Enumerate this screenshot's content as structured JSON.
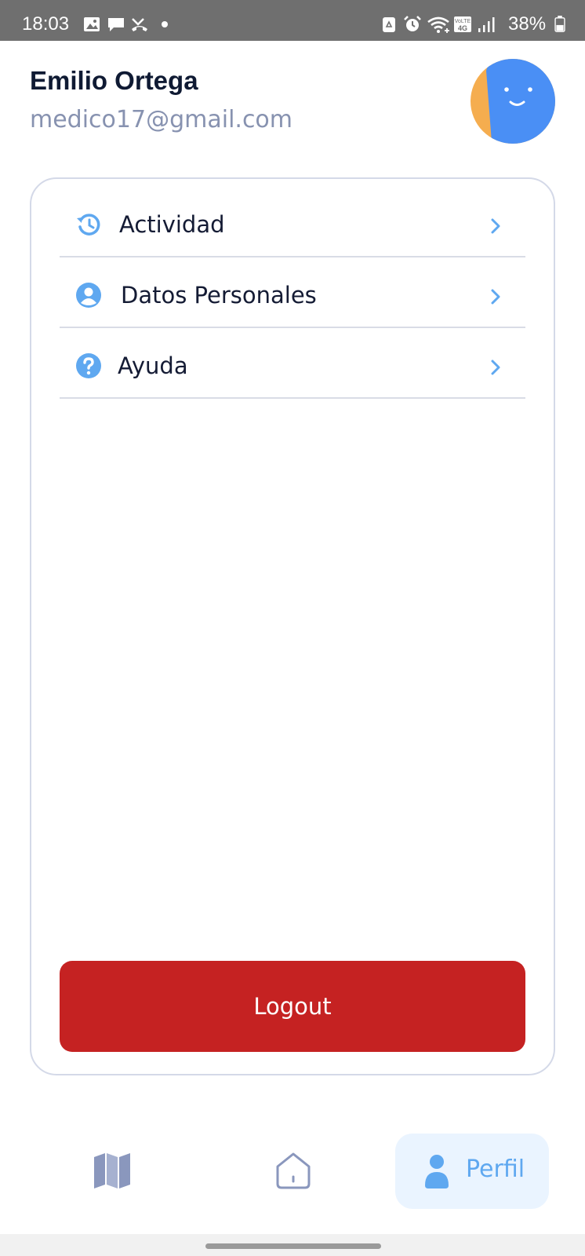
{
  "status_bar": {
    "time": "18:03",
    "battery_percent": "38%",
    "icons": [
      "gallery-icon",
      "chat-icon",
      "missed-call-icon",
      "dot-icon",
      "recycle-icon",
      "alarm-icon",
      "wifi-icon",
      "volte-4g-icon",
      "signal-icon",
      "battery-icon"
    ]
  },
  "profile": {
    "name": "Emilio Ortega",
    "email": "medico17@gmail.com"
  },
  "menu": {
    "items": [
      {
        "label": "Actividad",
        "icon": "history-icon"
      },
      {
        "label": "Datos Personales",
        "icon": "account-circle-icon"
      },
      {
        "label": "Ayuda",
        "icon": "help-icon"
      }
    ],
    "logout_label": "Logout"
  },
  "bottom_nav": {
    "items": [
      {
        "icon": "map-icon"
      },
      {
        "icon": "home-icon"
      },
      {
        "icon": "person-icon",
        "label": "Perfil",
        "selected": true
      }
    ]
  },
  "colors": {
    "accent_blue": "#5fa8f0",
    "logout_red": "#c52222",
    "avatar_orange": "#f5ad4f",
    "avatar_blue": "#4a8ff5",
    "nav_inactive": "#8a97bd"
  }
}
